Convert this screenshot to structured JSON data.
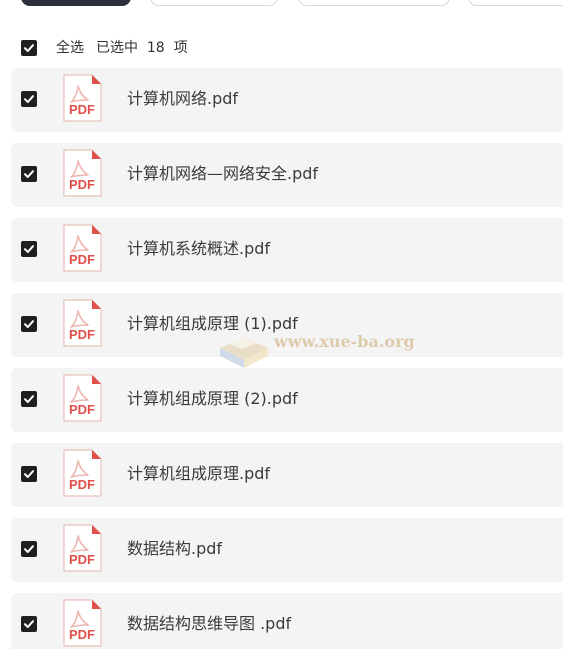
{
  "tabs": [
    {
      "label": "",
      "active": true
    },
    {
      "label": "",
      "active": false
    },
    {
      "label": "",
      "active": false
    },
    {
      "label": "",
      "active": false
    }
  ],
  "select_all": {
    "label": "全选",
    "status": "已选中  18  项",
    "checked": true
  },
  "files": [
    {
      "name": "计算机网络.pdf",
      "checked": true,
      "icon": "pdf-icon"
    },
    {
      "name": "计算机网络—网络安全.pdf",
      "checked": true,
      "icon": "pdf-icon"
    },
    {
      "name": "计算机系统概述.pdf",
      "checked": true,
      "icon": "pdf-icon"
    },
    {
      "name": "计算机组成原理 (1).pdf",
      "checked": true,
      "icon": "pdf-icon"
    },
    {
      "name": "计算机组成原理 (2).pdf",
      "checked": true,
      "icon": "pdf-icon"
    },
    {
      "name": "计算机组成原理.pdf",
      "checked": true,
      "icon": "pdf-icon"
    },
    {
      "name": "数据结构.pdf",
      "checked": true,
      "icon": "pdf-icon"
    },
    {
      "name": "数据结构思维导图 .pdf",
      "checked": true,
      "icon": "pdf-icon"
    }
  ],
  "pdf_icon_text": "PDF",
  "watermark": {
    "text": "www.xue-ba.org"
  },
  "colors": {
    "checkbox": "#1f1f1f",
    "row_bg": "#f4f4f4",
    "pdf_red": "#e0504a",
    "active_tab": "#2b2f3a"
  }
}
